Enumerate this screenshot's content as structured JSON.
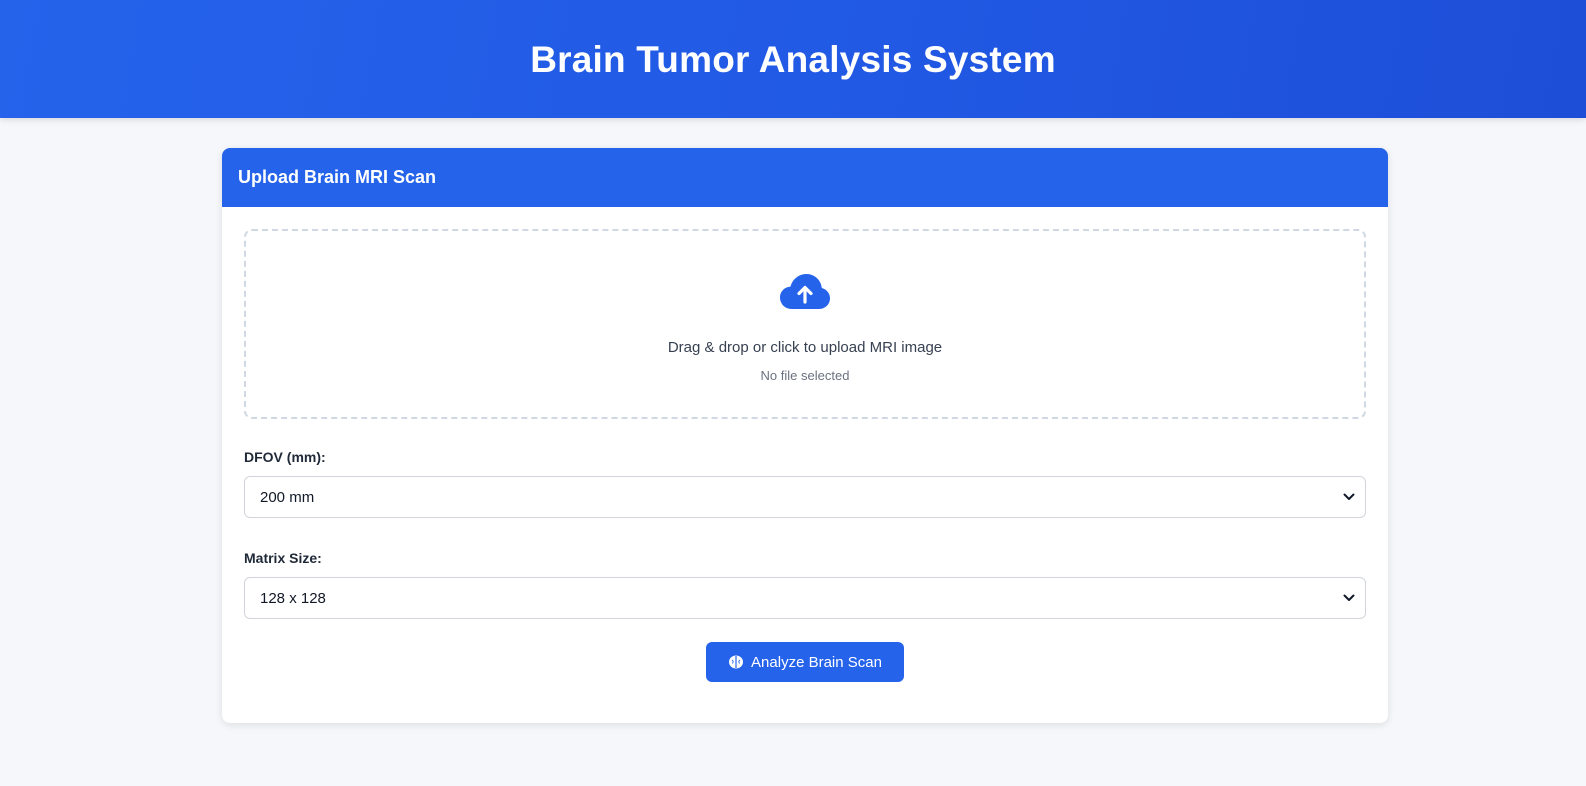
{
  "header": {
    "title": "Brain Tumor Analysis System"
  },
  "upload_card": {
    "title": "Upload Brain MRI Scan",
    "dropzone": {
      "icon": "cloud-upload-icon",
      "instruction": "Drag & drop or click to upload MRI image",
      "file_status": "No file selected"
    },
    "dfov": {
      "label": "DFOV (mm):",
      "selected": "200 mm"
    },
    "matrix": {
      "label": "Matrix Size:",
      "selected": "128 x 128"
    },
    "analyze_button": {
      "icon": "brain-icon",
      "label": "Analyze Brain Scan"
    }
  },
  "colors": {
    "primary": "#2563eb",
    "header_gradient_end": "#1d4ed8",
    "page_background": "#f5f7fa",
    "dropzone_border": "#cfd8e3"
  }
}
